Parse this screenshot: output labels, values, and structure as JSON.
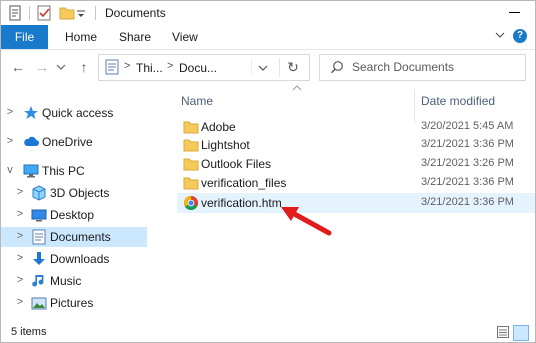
{
  "window": {
    "title": "Documents",
    "minimize_glyph": "—"
  },
  "ribbon": {
    "tabs": [
      {
        "label": "File"
      },
      {
        "label": "Home"
      },
      {
        "label": "Share"
      },
      {
        "label": "View"
      }
    ],
    "help_glyph": "?",
    "accent": "#1979ca"
  },
  "address": {
    "crumbs": [
      "Thi...",
      "Docu..."
    ],
    "separator": ">",
    "dropdown_glyph": "v",
    "refresh_glyph": "↻"
  },
  "nav_buttons": {
    "back": "←",
    "forward": "→",
    "recent": "v",
    "up": "↑"
  },
  "search": {
    "placeholder": "Search Documents"
  },
  "navpane": {
    "items": [
      {
        "label": "Quick access",
        "expander": ">",
        "icon": "star-icon"
      },
      {
        "label": "OneDrive",
        "expander": ">",
        "icon": "cloud-icon"
      },
      {
        "label": "This PC",
        "expander": "v",
        "icon": "computer-icon"
      },
      {
        "label": "3D Objects",
        "expander": ">",
        "icon": "cube-icon"
      },
      {
        "label": "Desktop",
        "expander": ">",
        "icon": "desktop-icon"
      },
      {
        "label": "Documents",
        "expander": ">",
        "icon": "documents-icon",
        "selected": true
      },
      {
        "label": "Downloads",
        "expander": ">",
        "icon": "download-icon"
      },
      {
        "label": "Music",
        "expander": ">",
        "icon": "music-icon"
      },
      {
        "label": "Pictures",
        "expander": ">",
        "icon": "pictures-icon"
      }
    ]
  },
  "columns": {
    "name": "Name",
    "date_modified": "Date modified",
    "sort_glyph": "^"
  },
  "files": [
    {
      "name": "Adobe",
      "date": "3/20/2021 5:45 AM",
      "icon": "folder-icon"
    },
    {
      "name": "Lightshot",
      "date": "3/21/2021 3:36 PM",
      "icon": "folder-icon"
    },
    {
      "name": "Outlook Files",
      "date": "3/21/2021 3:26 PM",
      "icon": "folder-icon"
    },
    {
      "name": "verification_files",
      "date": "3/21/2021 3:36 PM",
      "icon": "folder-icon"
    },
    {
      "name": "verification.htm",
      "date": "3/21/2021 3:36 PM",
      "icon": "chrome-icon",
      "selected": true
    }
  ],
  "status": {
    "item_count": "5 items"
  },
  "colors": {
    "folder": "#f6ca5a",
    "selected_nav": "#cce8ff",
    "selected_row": "#e5f3ff",
    "arrow": "#e21b1b"
  }
}
